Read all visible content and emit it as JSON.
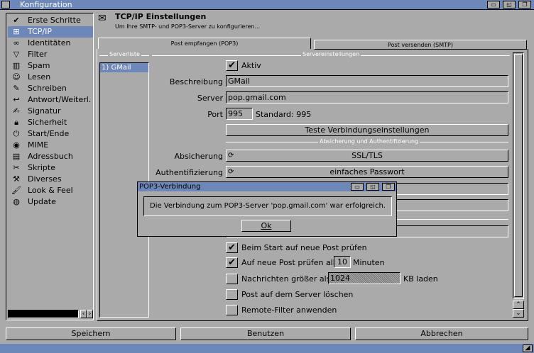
{
  "window": {
    "title": "Konfiguration"
  },
  "sidebar": {
    "items": [
      {
        "label": "Erste Schritte",
        "icon": "check"
      },
      {
        "label": "TCP/IP",
        "icon": "network"
      },
      {
        "label": "Identitäten",
        "icon": "glasses"
      },
      {
        "label": "Filter",
        "icon": "funnel"
      },
      {
        "label": "Spam",
        "icon": "bin"
      },
      {
        "label": "Lesen",
        "icon": "reader"
      },
      {
        "label": "Schreiben",
        "icon": "pen"
      },
      {
        "label": "Antwort/Weiterl.",
        "icon": "reply"
      },
      {
        "label": "Signatur",
        "icon": "signature"
      },
      {
        "label": "Sicherheit",
        "icon": "lock"
      },
      {
        "label": "Start/Ende",
        "icon": "power"
      },
      {
        "label": "MIME",
        "icon": "eye"
      },
      {
        "label": "Adressbuch",
        "icon": "book"
      },
      {
        "label": "Skripte",
        "icon": "script"
      },
      {
        "label": "Diverses",
        "icon": "tools"
      },
      {
        "label": "Look & Feel",
        "icon": "brush"
      },
      {
        "label": "Update",
        "icon": "globe"
      }
    ],
    "selected": 1
  },
  "header": {
    "title": "TCP/IP Einstellungen",
    "subtitle": "Um Ihre SMTP- und POP3-Server zu konfigurieren..."
  },
  "tabs": [
    {
      "label": "Post empfangen (POP3)"
    },
    {
      "label": "Post versenden (SMTP)"
    }
  ],
  "serverlist": {
    "title": "Serverliste",
    "items": [
      "1) GMail"
    ]
  },
  "settings": {
    "title": "Servereinstellungen",
    "active_label": "Aktiv",
    "desc_label": "Beschreibung",
    "desc_value": "GMail",
    "server_label": "Server",
    "server_value": "pop.gmail.com",
    "port_label": "Port",
    "port_value": "995",
    "port_default": "Standard: 995",
    "test_button": "Teste Verbindungseinstellungen",
    "auth_group": "Absicherung und Authentifizierung",
    "security_label": "Absicherung",
    "security_value": "SSL/TLS",
    "auth_label": "Authentifizierung",
    "auth_value": "einfaches Passwort",
    "opt1": "Beim Start auf neue Post prüfen",
    "opt2_pre": "Auf neue Post prüfen alle",
    "opt2_value": "10",
    "opt2_post": "Minuten",
    "opt3_pre": "Nachrichten größer als",
    "opt3_value": "1024",
    "opt3_post": "KB laden",
    "opt4": "Post auf dem Server löschen",
    "opt5": "Remote-Filter anwenden"
  },
  "dialog": {
    "title": "POP3-Verbindung",
    "message": "Die Verbindung zum POP3-Server 'pop.gmail.com' war erfolgreich.",
    "ok": "Ok"
  },
  "footer": {
    "save": "Speichern",
    "use": "Benutzen",
    "cancel": "Abbrechen"
  }
}
